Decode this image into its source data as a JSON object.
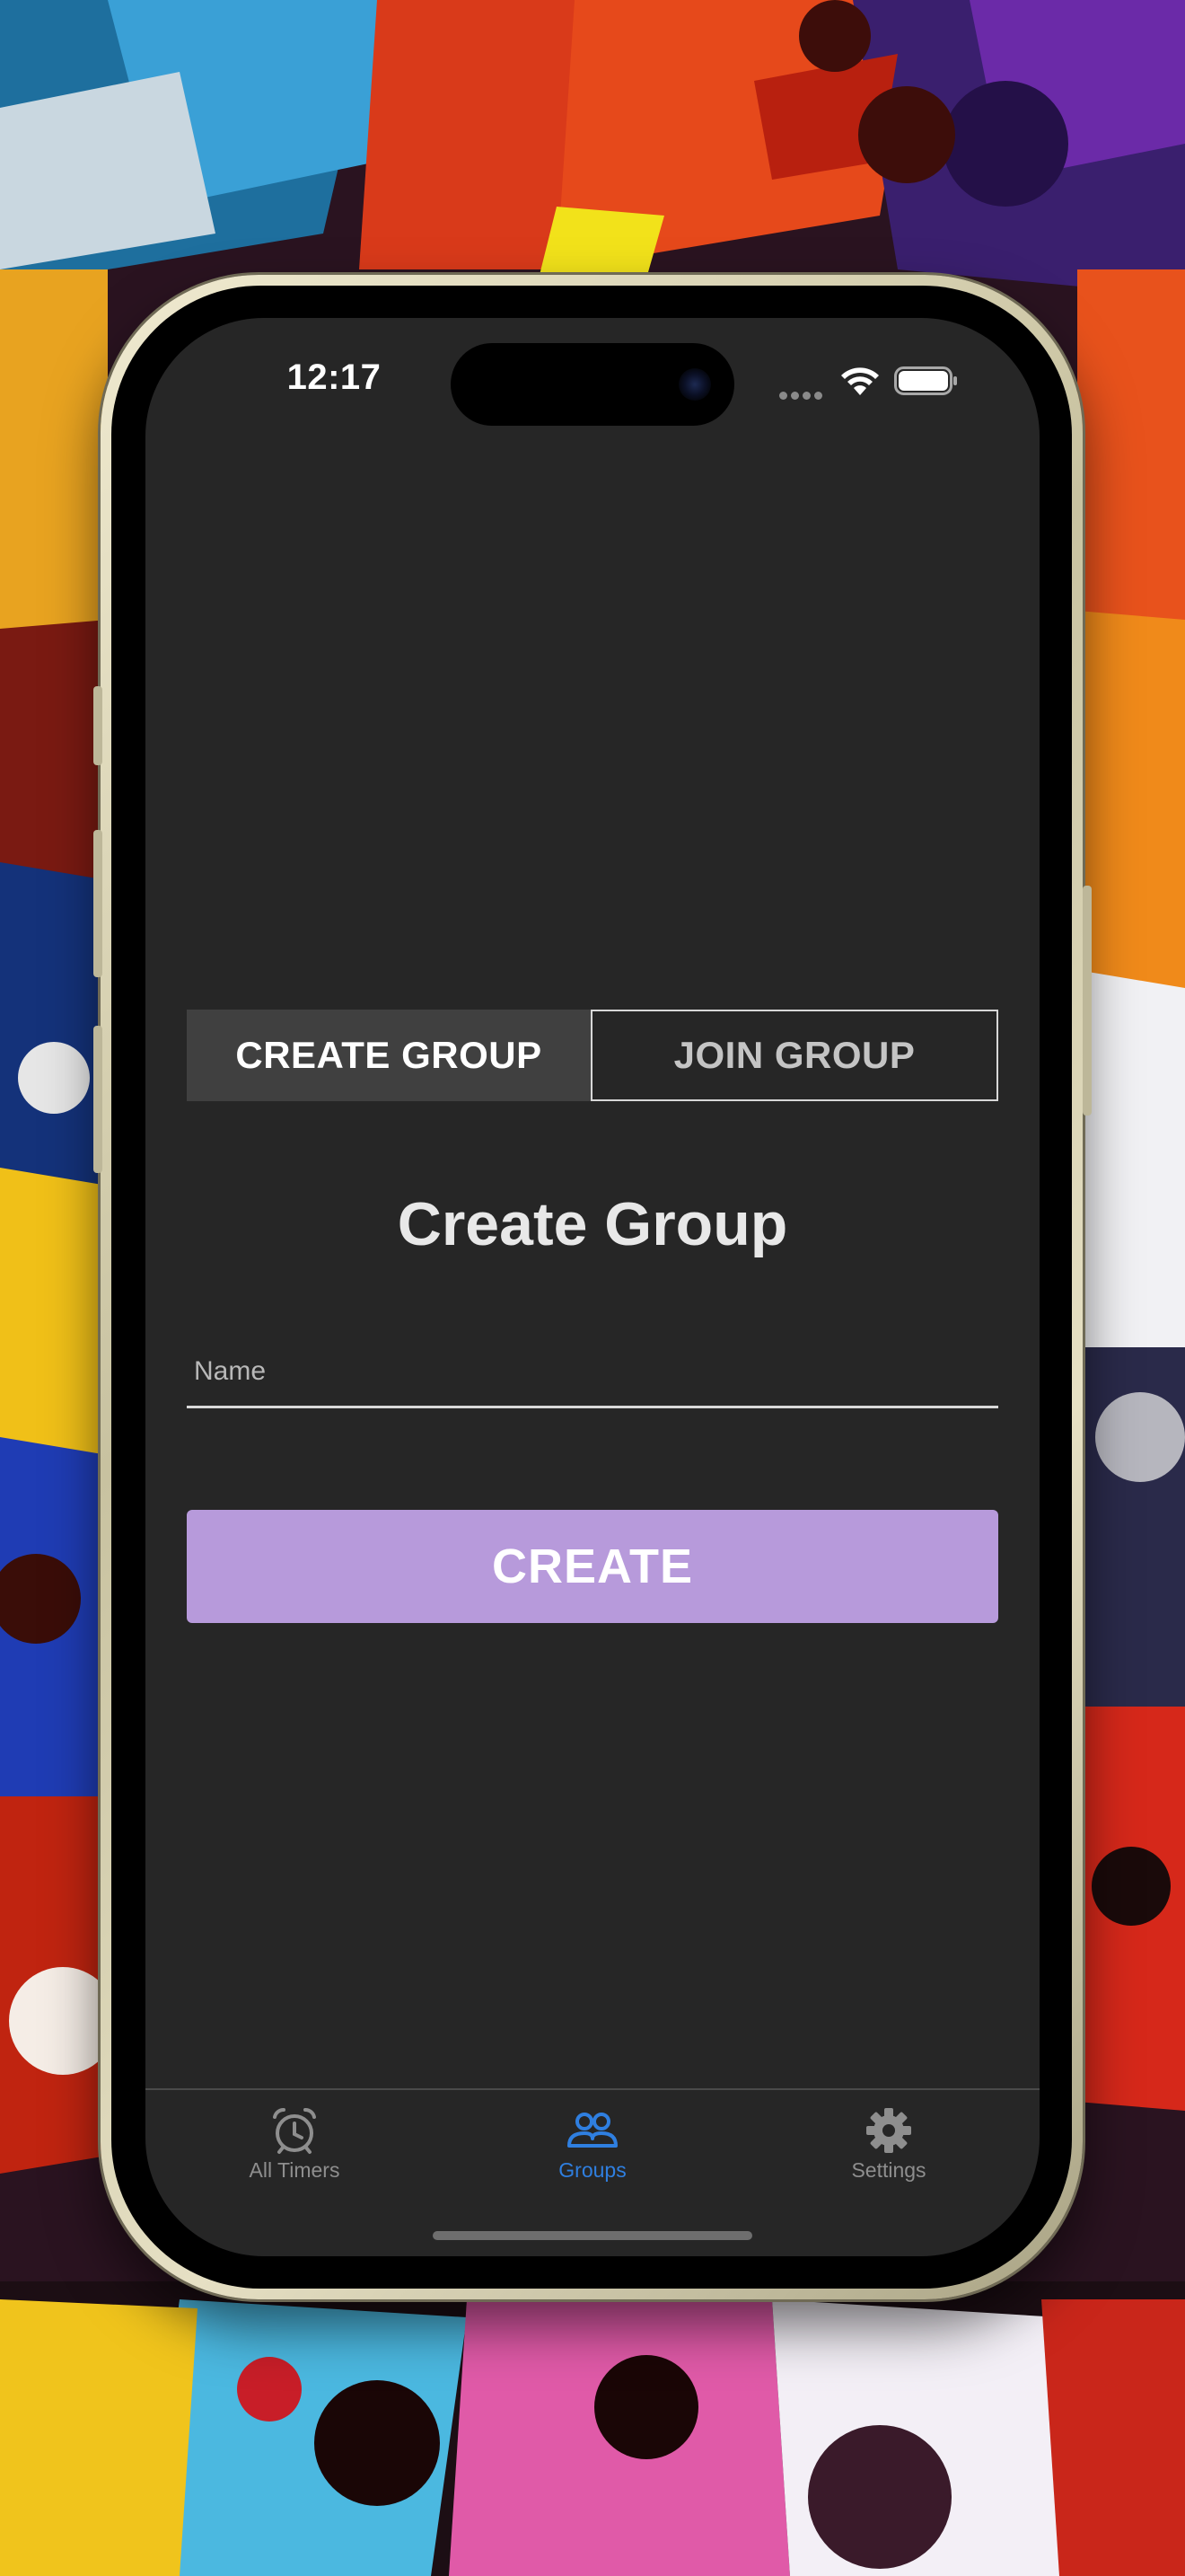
{
  "status_bar": {
    "time": "12:17"
  },
  "segmented_control": {
    "tabs": [
      {
        "label": "CREATE GROUP",
        "active": true
      },
      {
        "label": "JOIN GROUP",
        "active": false
      }
    ]
  },
  "main": {
    "title": "Create Group",
    "name_input": {
      "placeholder": "Name",
      "value": ""
    },
    "create_button_label": "CREATE"
  },
  "tab_bar": {
    "items": [
      {
        "label": "All Timers",
        "icon": "alarm-clock-icon",
        "active": false
      },
      {
        "label": "Groups",
        "icon": "people-icon",
        "active": true
      },
      {
        "label": "Settings",
        "icon": "gear-icon",
        "active": false
      }
    ]
  },
  "colors": {
    "screen_background": "#262626",
    "accent_button": "#b79adb",
    "active_tab": "#2f7fe0",
    "inactive_tab": "#8e8e8e",
    "segment_active": "#404040"
  }
}
